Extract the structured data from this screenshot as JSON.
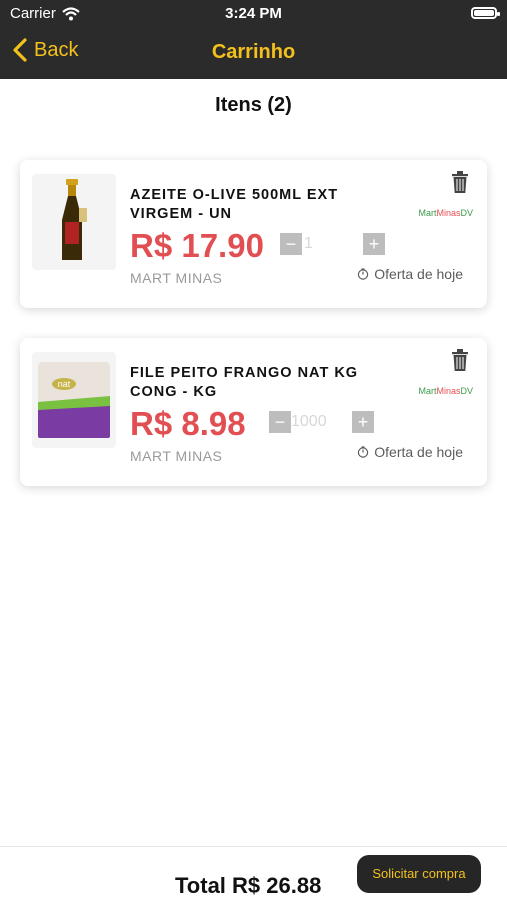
{
  "status_bar": {
    "carrier": "Carrier",
    "time": "3:24 PM"
  },
  "nav": {
    "back_label": "Back",
    "title": "Carrinho"
  },
  "items_title": "Itens (2)",
  "cart": [
    {
      "name": "AZEITE O-LIVE 500ML EXT VIRGEM - UN",
      "price": "R$ 17.90",
      "quantity": "1",
      "store": "MART MINAS",
      "offer": "Oferta de hoje",
      "logo_part1": "Mart",
      "logo_part2": "Minas",
      "logo_part3": "DV"
    },
    {
      "name": "FILE PEITO FRANGO NAT KG CONG - KG",
      "price": "R$ 8.98",
      "quantity": "1000",
      "store": "MART MINAS",
      "offer": "Oferta de hoje",
      "logo_part1": "Mart",
      "logo_part2": "Minas",
      "logo_part3": "DV"
    }
  ],
  "footer": {
    "total_label": "Total R$ 26.88",
    "buy_label": "Solicitar compra"
  },
  "icons": [
    "wifi-icon",
    "battery-icon",
    "chevron-left-icon",
    "trash-icon",
    "timer-icon",
    "minus-icon",
    "plus-icon"
  ],
  "colors": {
    "header_bg": "#2b2b2b",
    "accent": "#f3c11b",
    "price": "#e24f53",
    "button_bg": "#262626"
  }
}
